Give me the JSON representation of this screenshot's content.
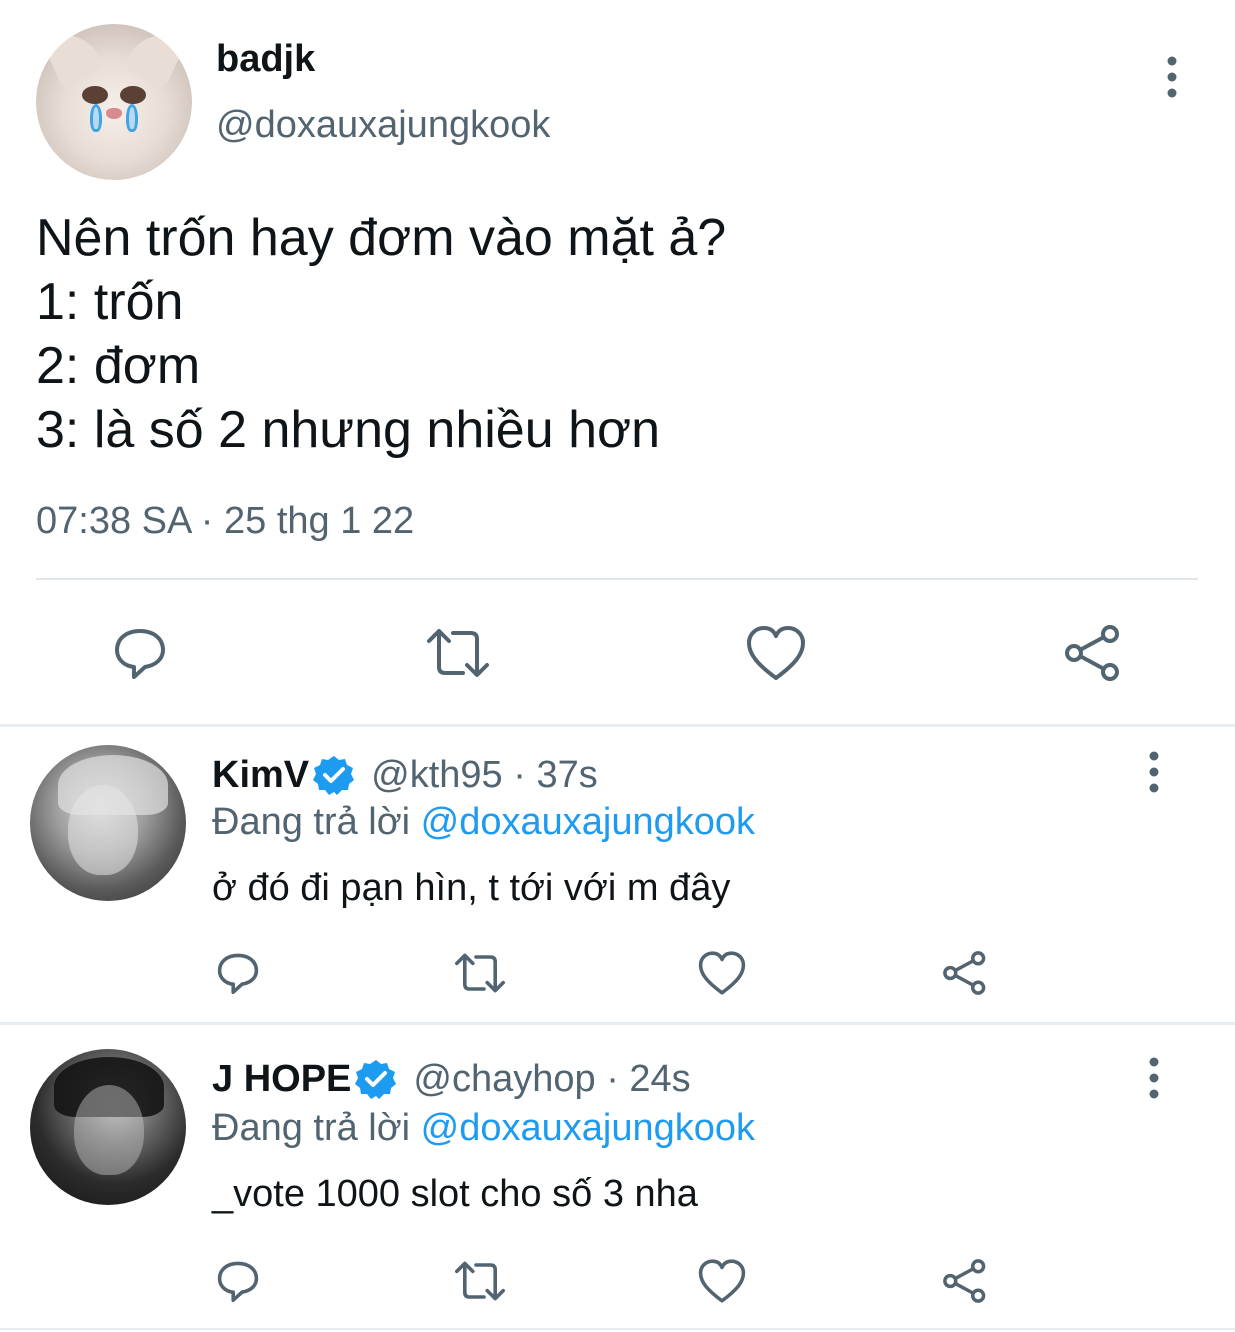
{
  "colors": {
    "text": "#0f1419",
    "secondary": "#536471",
    "link": "#1d9bf0",
    "divider": "#e1e6ea"
  },
  "main_tweet": {
    "display_name": "badjk",
    "handle": "@doxauxajungkook",
    "text_lines": [
      "Nên trốn hay đơm vào mặt ả?",
      "1: trốn",
      "2: đơm",
      "3: là số 2 nhưng nhiều hơn"
    ],
    "timestamp": "07:38 SA · 25 thg 1 22",
    "actions": [
      "reply-icon",
      "retweet-icon",
      "like-icon",
      "share-icon"
    ]
  },
  "replies": [
    {
      "display_name": "KimV",
      "verified": true,
      "handle_time": "@kth95 · 37s",
      "replying_prefix": "Đang trả lời ",
      "replying_to": "@doxauxajungkook",
      "text": "ở đó đi pạn hìn, t tới với m đây"
    },
    {
      "display_name": "J HOPE",
      "verified": true,
      "handle_time": "@chayhop · 24s",
      "replying_prefix": "Đang trả lời ",
      "replying_to": "@doxauxajungkook",
      "text": "_vote 1000 slot cho số 3 nha"
    }
  ]
}
